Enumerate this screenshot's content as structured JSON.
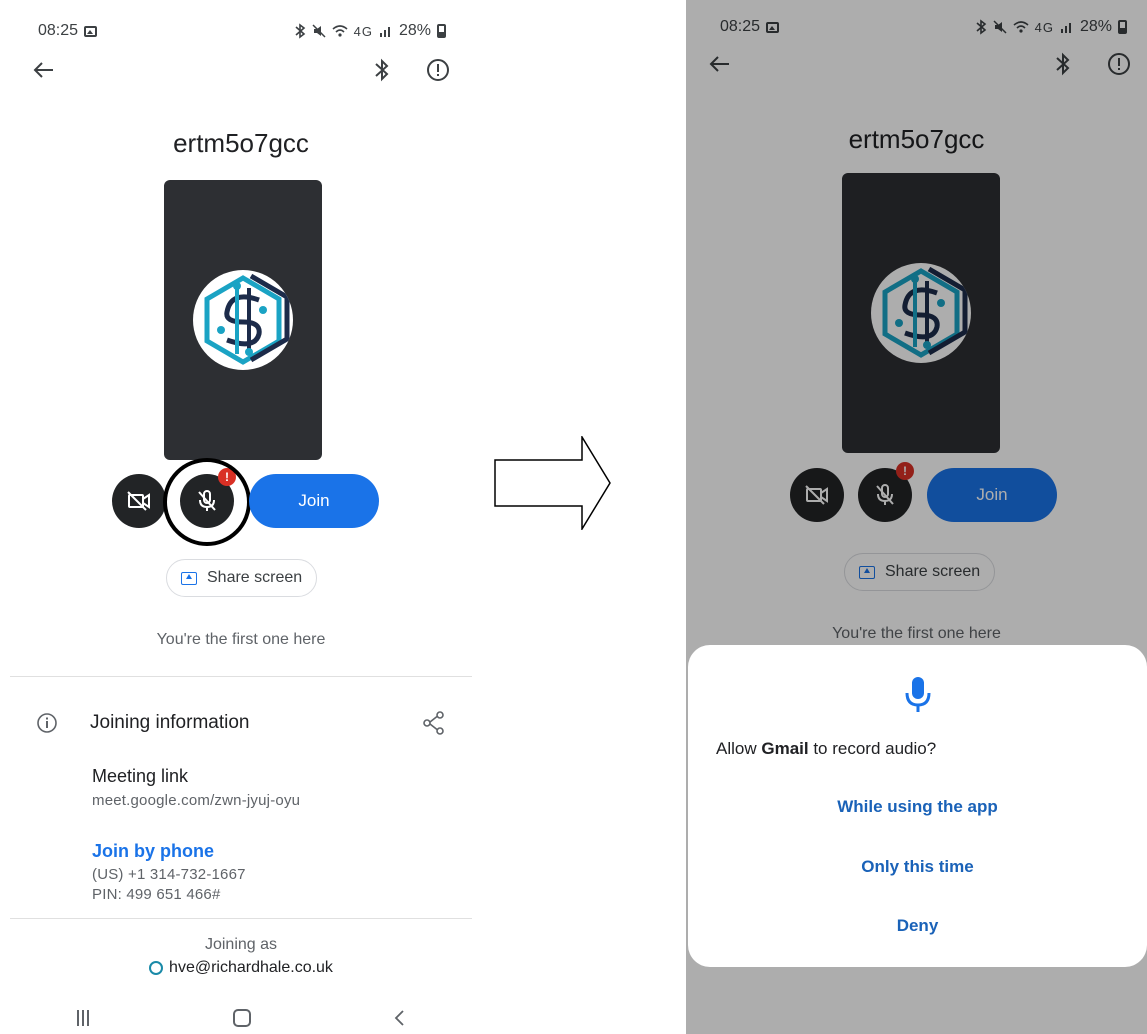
{
  "status_bar": {
    "time": "08:25",
    "signal_text": "4G",
    "battery": "28%"
  },
  "meeting": {
    "code": "ertm5o7gcc"
  },
  "controls": {
    "join_label": "Join",
    "mic_badge": "!"
  },
  "share": {
    "label": "Share screen"
  },
  "first_text": "You're the first one here",
  "joining_info": {
    "heading": "Joining information",
    "meeting_link_label": "Meeting link",
    "meeting_link": "meet.google.com/zwn-jyuj-oyu",
    "join_by_phone_label": "Join by phone",
    "phone_number": "(US) +1 314-732-1667",
    "pin": "PIN: 499 651 466#"
  },
  "joining_as": {
    "label": "Joining as",
    "email": "hve@richardhale.co.uk"
  },
  "permission_dialog": {
    "question_prefix": "Allow ",
    "app_name": "Gmail",
    "question_suffix": " to record audio?",
    "options": [
      "While using the app",
      "Only this time",
      "Deny"
    ]
  },
  "colors": {
    "accent": "#1a73e8",
    "badge": "#d93025",
    "preview_bg": "#2d2f33",
    "highlight_ring": "#000000"
  },
  "icons": [
    "back-arrow-icon",
    "bluetooth-icon",
    "report-icon",
    "camera-off-icon",
    "mic-off-icon",
    "share-screen-icon",
    "info-icon",
    "share-icon",
    "mic-icon"
  ]
}
